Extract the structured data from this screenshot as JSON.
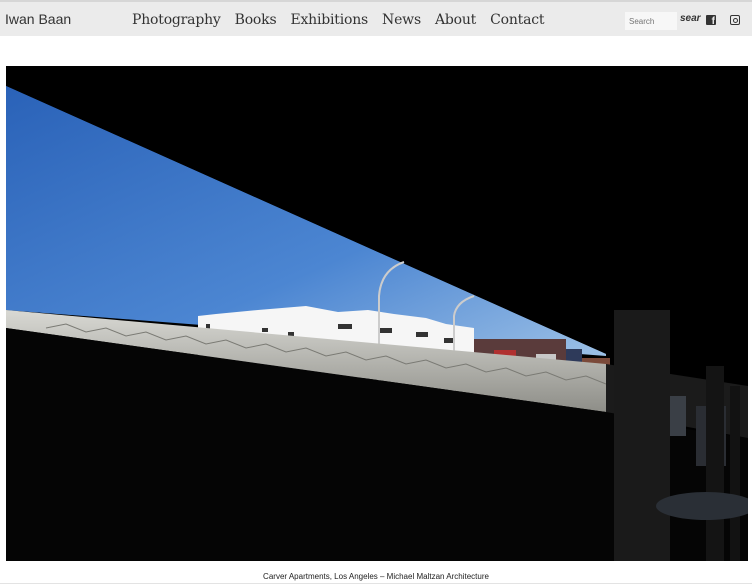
{
  "site": {
    "logo": "Iwan Baan"
  },
  "nav": {
    "items": [
      "Photography",
      "Books",
      "Exhibitions",
      "News",
      "About",
      "Contact"
    ]
  },
  "search": {
    "placeholder": "Search",
    "button_label": "sear"
  },
  "social": {
    "icons": [
      "facebook-icon",
      "instagram-icon"
    ]
  },
  "photo": {
    "caption": "Carver Apartments, Los Angeles – Michael Maltzan Architecture"
  },
  "colors": {
    "header_bg": "#ebebeb",
    "sky": "#3f74c4",
    "photo_bg": "#000000"
  }
}
